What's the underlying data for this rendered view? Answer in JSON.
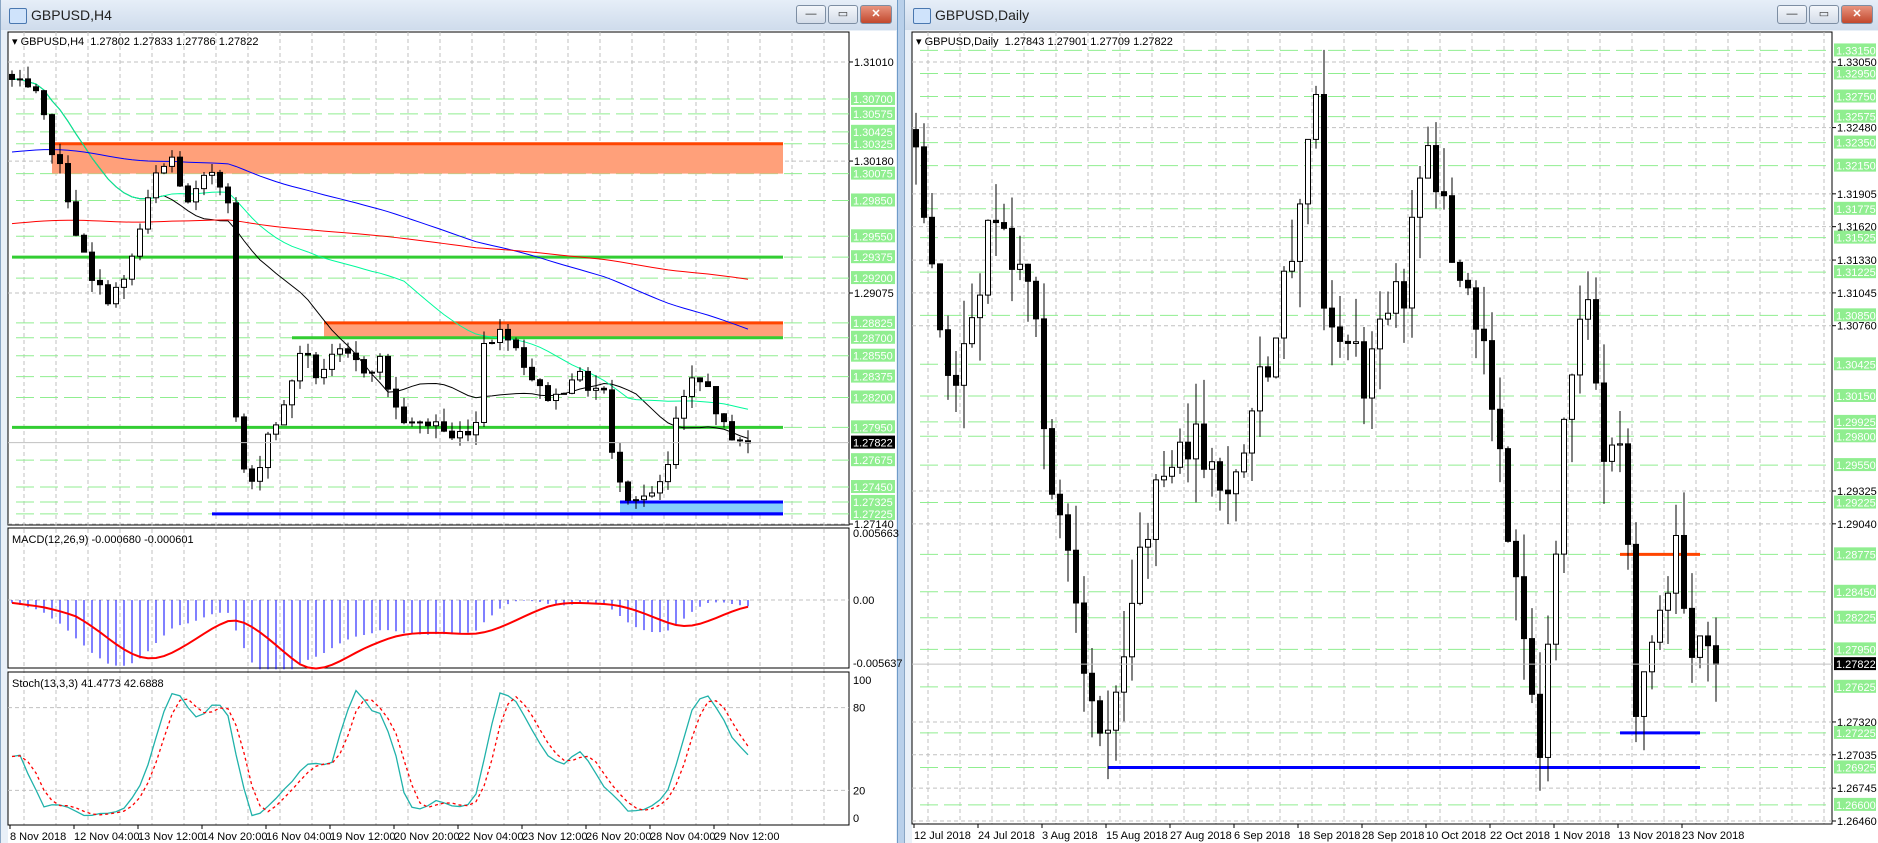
{
  "left_window": {
    "title": "GBPUSD,H4",
    "header": "GBPUSD,H4  1.27802 1.27833 1.27786 1.27822",
    "buttons": {
      "minimize": "—",
      "restore": "▭",
      "close": "✕"
    }
  },
  "right_window": {
    "title": "GBPUSD,Daily",
    "header": "GBPUSD,Daily  1.27843 1.27901 1.27709 1.27822",
    "buttons": {
      "minimize": "—",
      "restore": "▭",
      "close": "✕"
    }
  },
  "colors": {
    "green_level": "#90ee90",
    "zone_fill": "#ffa07a",
    "zone_line": "#ff4500",
    "blue_zone": "#87cefa",
    "blue_line": "#0000ff",
    "bull": "#ffffff",
    "bear": "#000000"
  },
  "chart_data": [
    {
      "type": "candlestick",
      "title": "GBPUSD,H4",
      "ylim": [
        1.27132,
        1.31261
      ],
      "current_price": "1.27822",
      "price_ticks": [
        "1.31010",
        "1.30180",
        "1.29075",
        "1.27140"
      ],
      "level_labels": [
        "1.30700",
        "1.30575",
        "1.30425",
        "1.30325",
        "1.30075",
        "1.29850",
        "1.29550",
        "1.29375",
        "1.29200",
        "1.28825",
        "1.28700",
        "1.28550",
        "1.28375",
        "1.28200",
        "1.27950",
        "1.27675",
        "1.27450",
        "1.27325",
        "1.27225"
      ],
      "x_labels": [
        "8 Nov 2018",
        "12 Nov 04:00",
        "13 Nov 12:00",
        "14 Nov 20:00",
        "16 Nov 04:00",
        "19 Nov 12:00",
        "20 Nov 20:00",
        "22 Nov 04:00",
        "23 Nov 12:00",
        "26 Nov 20:00",
        "28 Nov 04:00",
        "29 Nov 12:00"
      ],
      "bars": 93,
      "close_keyframes": [
        [
          0,
          1.3085
        ],
        [
          3,
          1.307
        ],
        [
          5,
          1.303
        ],
        [
          7,
          1.299
        ],
        [
          8,
          1.296
        ],
        [
          10,
          1.2915
        ],
        [
          12,
          1.2905
        ],
        [
          14,
          1.2915
        ],
        [
          16,
          1.296
        ],
        [
          18,
          1.3005
        ],
        [
          20,
          1.302
        ],
        [
          22,
          1.298
        ],
        [
          25,
          1.301
        ],
        [
          27,
          1.299
        ],
        [
          28,
          1.28
        ],
        [
          29,
          1.276
        ],
        [
          30,
          1.2745
        ],
        [
          32,
          1.279
        ],
        [
          34,
          1.281
        ],
        [
          36,
          1.286
        ],
        [
          38,
          1.284
        ],
        [
          41,
          1.2855
        ],
        [
          44,
          1.2845
        ],
        [
          46,
          1.285
        ],
        [
          48,
          1.281
        ],
        [
          50,
          1.2795
        ],
        [
          53,
          1.28
        ],
        [
          55,
          1.2785
        ],
        [
          58,
          1.28
        ],
        [
          59,
          1.287
        ],
        [
          62,
          1.2875
        ],
        [
          64,
          1.285
        ],
        [
          66,
          1.2825
        ],
        [
          68,
          1.282
        ],
        [
          70,
          1.284
        ],
        [
          72,
          1.283
        ],
        [
          74,
          1.2825
        ],
        [
          75,
          1.277
        ],
        [
          77,
          1.274
        ],
        [
          80,
          1.2735
        ],
        [
          82,
          1.276
        ],
        [
          83,
          1.28
        ],
        [
          85,
          1.283
        ],
        [
          87,
          1.2835
        ],
        [
          88,
          1.28
        ],
        [
          90,
          1.279
        ],
        [
          92,
          1.2782
        ]
      ],
      "moving_averages": [
        {
          "period": 20,
          "color": "#000000"
        },
        {
          "period": 50,
          "color": "#00fa9a"
        },
        {
          "period": 100,
          "color": "#0000ff"
        },
        {
          "period": 200,
          "color": "#ff0000"
        }
      ],
      "zones": [
        {
          "kind": "rect",
          "from": 1.30325,
          "to": 1.30075,
          "start_bar": 5,
          "fill": "#ffa07a",
          "edge": "#ff4500"
        },
        {
          "kind": "rect",
          "from": 1.28825,
          "to": 1.287,
          "start_bar": 39,
          "fill": "#ffa07a",
          "edge": "#ff4500"
        },
        {
          "kind": "rect",
          "from": 1.27325,
          "to": 1.27225,
          "start_bar": 76,
          "fill": "#87cefa",
          "edge": "#0000ff"
        }
      ],
      "lines": [
        {
          "price": 1.29375,
          "start_bar": 0,
          "color": "#32cd32"
        },
        {
          "price": 1.287,
          "start_bar": 35,
          "color": "#32cd32"
        },
        {
          "price": 1.2795,
          "start_bar": 0,
          "color": "#32cd32"
        },
        {
          "price": 1.27225,
          "start_bar": 25,
          "color": "#0000ff"
        }
      ],
      "macd": {
        "label": "MACD(12,26,9) -0.000680 -0.000601",
        "top": "0.005663",
        "zero": "0.00",
        "bottom": "-0.005637",
        "range": [
          -0.005637,
          0.005663
        ]
      },
      "stoch": {
        "label": "Stoch(13,3,3) 41.4773 42.6888",
        "ticks": [
          "100",
          "80",
          "20",
          "0"
        ]
      }
    },
    {
      "type": "candlestick",
      "title": "GBPUSD,Daily",
      "ylim": [
        1.26434,
        1.3331
      ],
      "current_price": "1.27822",
      "price_ticks": [
        "1.33050",
        "1.32480",
        "1.31905",
        "1.31620",
        "1.31330",
        "1.31045",
        "1.30760",
        "1.29325",
        "1.29040",
        "1.27320",
        "1.27035",
        "1.26745",
        "1.26460"
      ],
      "level_labels": [
        "1.33150",
        "1.32950",
        "1.32750",
        "1.32575",
        "1.32350",
        "1.32150",
        "1.31775",
        "1.31525",
        "1.31225",
        "1.30850",
        "1.30425",
        "1.30150",
        "1.29925",
        "1.29800",
        "1.29550",
        "1.29225",
        "1.28775",
        "1.28450",
        "1.28225",
        "1.27950",
        "1.27625",
        "1.27225",
        "1.26925",
        "1.26600"
      ],
      "x_labels": [
        "12 Jul 2018",
        "24 Jul 2018",
        "3 Aug 2018",
        "15 Aug 2018",
        "27 Aug 2018",
        "6 Sep 2018",
        "18 Sep 2018",
        "28 Sep 2018",
        "10 Oct 2018",
        "22 Oct 2018",
        "1 Nov 2018",
        "13 Nov 2018",
        "23 Nov 2018"
      ],
      "bars": 101,
      "close_keyframes": [
        [
          0,
          1.321
        ],
        [
          5,
          1.3
        ],
        [
          9,
          1.316
        ],
        [
          14,
          1.3125
        ],
        [
          16,
          1.2995
        ],
        [
          21,
          1.2765
        ],
        [
          24,
          1.27
        ],
        [
          28,
          1.29
        ],
        [
          34,
          1.298
        ],
        [
          40,
          1.294
        ],
        [
          44,
          1.305
        ],
        [
          50,
          1.326
        ],
        [
          51,
          1.307
        ],
        [
          56,
          1.303
        ],
        [
          61,
          1.311
        ],
        [
          64,
          1.323
        ],
        [
          67,
          1.3155
        ],
        [
          72,
          1.301
        ],
        [
          76,
          1.2815
        ],
        [
          78,
          1.271
        ],
        [
          81,
          1.297
        ],
        [
          84,
          1.312
        ],
        [
          86,
          1.297
        ],
        [
          88,
          1.2995
        ],
        [
          90,
          1.276
        ],
        [
          95,
          1.2875
        ],
        [
          97,
          1.2805
        ],
        [
          100,
          1.2782
        ]
      ],
      "lines": [
        {
          "price": 1.28775,
          "start_bar": 88,
          "end_bar": 98,
          "color": "#ff4500"
        },
        {
          "price": 1.27225,
          "start_bar": 88,
          "end_bar": 98,
          "color": "#0000ff"
        },
        {
          "price": 1.26925,
          "start_bar": 24,
          "end_bar": 98,
          "color": "#0000ff"
        }
      ]
    }
  ]
}
